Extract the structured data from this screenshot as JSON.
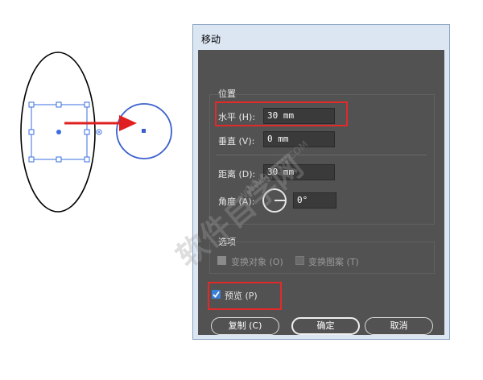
{
  "dialog": {
    "title": "移动",
    "position": {
      "heading": "位置",
      "horizontal_label": "水平 (H):",
      "horizontal_value": "30 mm",
      "vertical_label": "垂直 (V):",
      "vertical_value": "0 mm",
      "distance_label": "距离 (D):",
      "distance_value": "30 mm",
      "angle_label": "角度 (A):",
      "angle_value": "0°"
    },
    "options": {
      "heading": "选项",
      "transform_objects": "变换对象 (O)",
      "transform_objects_checked": true,
      "transform_patterns": "变换图案 (T)",
      "transform_patterns_checked": false
    },
    "preview_label": "预览 (P)",
    "preview_checked": true,
    "buttons": {
      "copy": "复制 (C)",
      "ok": "确定",
      "cancel": "取消"
    }
  },
  "watermark": {
    "main": "软件自学网",
    "url": "WWW.RJZXW.COM"
  },
  "colors": {
    "highlight": "#e22a2a",
    "shape_blue": "#3a5fcd",
    "dialog_bg": "#525252",
    "arrow": "#e02020"
  }
}
